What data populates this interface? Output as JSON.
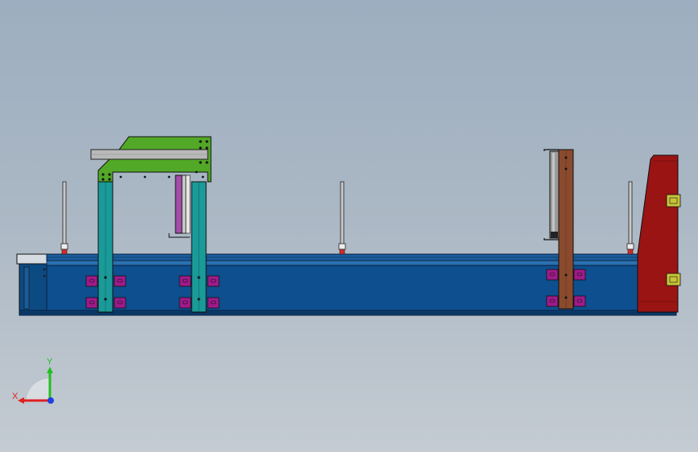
{
  "axes": {
    "x_label": "X",
    "y_label": "Y",
    "x_color": "#e02020",
    "y_color": "#20c020",
    "z_color": "#2040e0"
  },
  "colors": {
    "rail": "#0d4f8f",
    "rail_edge": "#062b55",
    "column": "#1a9a98",
    "green_head": "#52a827",
    "cylinder": "#a44ca8",
    "brown_post": "#8a4a2e",
    "red_block": "#9a1414",
    "clamp": "#a01a8a",
    "bracket": "#c8c43a",
    "bar": "#b9b9b9",
    "red_pin": "#d22b2b"
  }
}
